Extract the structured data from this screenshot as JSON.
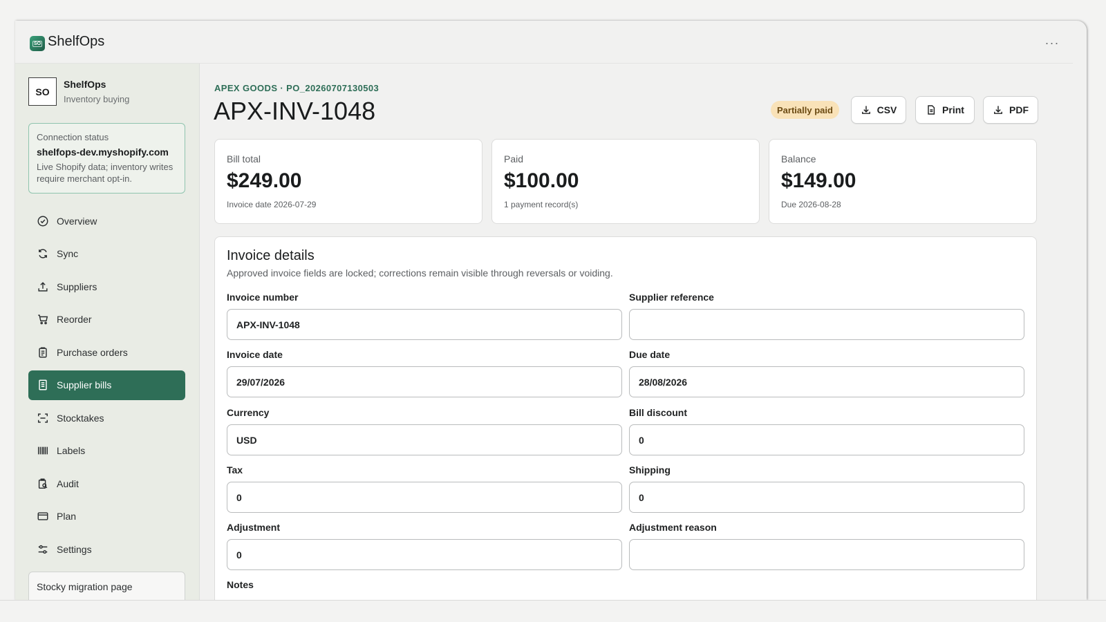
{
  "app": {
    "title": "ShelfOps",
    "logo_text": "SO",
    "more_glyph": "···"
  },
  "sidebar": {
    "shop_initials": "SO",
    "shop_name": "ShelfOps",
    "shop_subtitle": "Inventory buying",
    "connection": {
      "label": "Connection status",
      "domain": "shelfops-dev.myshopify.com",
      "note": "Live Shopify data; inventory writes require merchant opt-in."
    },
    "items": [
      {
        "label": "Overview",
        "icon": "check-circle-icon"
      },
      {
        "label": "Sync",
        "icon": "refresh-icon"
      },
      {
        "label": "Suppliers",
        "icon": "upload-icon"
      },
      {
        "label": "Reorder",
        "icon": "cart-icon"
      },
      {
        "label": "Purchase orders",
        "icon": "clipboard-icon"
      },
      {
        "label": "Supplier bills",
        "icon": "receipt-icon",
        "active": true
      },
      {
        "label": "Stocktakes",
        "icon": "scan-icon"
      },
      {
        "label": "Labels",
        "icon": "barcode-icon"
      },
      {
        "label": "Audit",
        "icon": "audit-icon"
      },
      {
        "label": "Plan",
        "icon": "credit-card-icon"
      },
      {
        "label": "Settings",
        "icon": "sliders-icon"
      }
    ],
    "migration_label": "Stocky migration page"
  },
  "page": {
    "eyebrow": "APEX GOODS · PO_20260707130503",
    "title": "APX-INV-1048",
    "status_badge": "Partially paid",
    "actions": {
      "csv": "CSV",
      "print": "Print",
      "pdf": "PDF"
    }
  },
  "stats": [
    {
      "label": "Bill total",
      "value": "$249.00",
      "sub": "Invoice date 2026-07-29"
    },
    {
      "label": "Paid",
      "value": "$100.00",
      "sub": "1 payment record(s)"
    },
    {
      "label": "Balance",
      "value": "$149.00",
      "sub": "Due 2026-08-28"
    }
  ],
  "details": {
    "title": "Invoice details",
    "description": "Approved invoice fields are locked; corrections remain visible through reversals or voiding.",
    "fields": {
      "invoice_number": {
        "label": "Invoice number",
        "value": "APX-INV-1048"
      },
      "supplier_reference": {
        "label": "Supplier reference",
        "value": ""
      },
      "invoice_date": {
        "label": "Invoice date",
        "value": "29/07/2026"
      },
      "due_date": {
        "label": "Due date",
        "value": "28/08/2026"
      },
      "currency": {
        "label": "Currency",
        "value": "USD"
      },
      "bill_discount": {
        "label": "Bill discount",
        "value": "0"
      },
      "tax": {
        "label": "Tax",
        "value": "0"
      },
      "shipping": {
        "label": "Shipping",
        "value": "0"
      },
      "adjustment": {
        "label": "Adjustment",
        "value": "0"
      },
      "adjustment_reason": {
        "label": "Adjustment reason",
        "value": ""
      },
      "notes": {
        "label": "Notes"
      }
    }
  },
  "colors": {
    "accent": "#2e6e57",
    "badge_bg": "#f9e2b8",
    "badge_text": "#6b4a12",
    "sidebar_bg": "#e9ece5"
  }
}
